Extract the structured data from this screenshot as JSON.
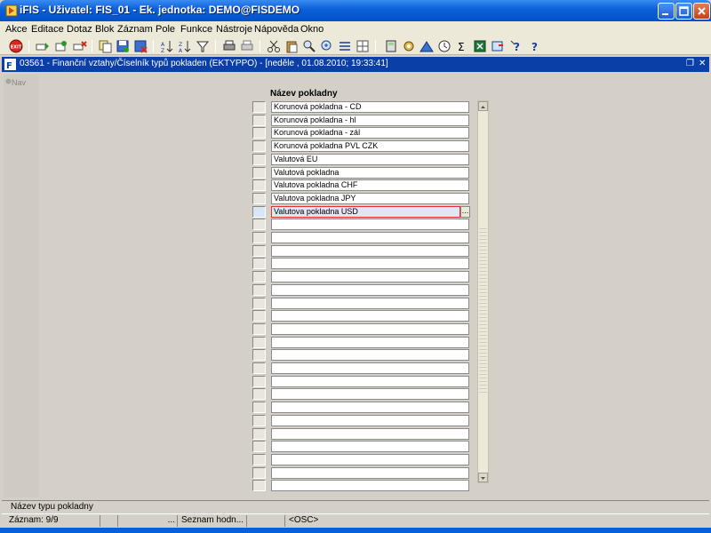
{
  "window": {
    "title": "iFIS - Uživatel: FIS_01 - Ek. jednotka: DEMO@FISDEMO"
  },
  "menu": [
    "Akce",
    "Editace",
    "Dotaz",
    "Blok",
    "Záznam",
    "Pole",
    "Funkce",
    "Nástroje",
    "Nápověda",
    "Okno"
  ],
  "toolbar": {
    "icons": [
      "exit-icon",
      "insert-record-icon",
      "duplicate-record-icon",
      "delete-record-icon",
      "copy-icon",
      "save-icon",
      "cancel-icon",
      "sort-asc-icon",
      "sort-desc-icon",
      "filter-icon",
      "print-icon",
      "print-preview-icon",
      "cut-icon",
      "paste-icon",
      "find-icon",
      "zoom-icon",
      "list-icon",
      "columns-icon",
      "calc-icon",
      "gear-icon",
      "chart-icon",
      "clock-icon",
      "sum-icon",
      "excel-icon",
      "export-icon",
      "help-icon",
      "context-help-icon"
    ],
    "exit_label": "EXIT"
  },
  "form": {
    "title": "03561 - Finanční vztahy/Číselník typů pokladen (EKTYPPO) - [neděle , 01.08.2010; 19:33:41]",
    "nav_label": "Nav",
    "column_header": "Název pokladny",
    "rows": [
      "Korunová pokladna - CD",
      "Korunová pokladna - hl",
      "Korunová pokladna - zál",
      "Korunová pokladna PVL CZK",
      "Valutová EU",
      "Valutová pokladna",
      "Valutova pokladna CHF",
      "Valutova pokladna JPY",
      "Valutova pokladna USD",
      "",
      "",
      "",
      "",
      "",
      "",
      "",
      "",
      "",
      "",
      "",
      "",
      "",
      "",
      "",
      "",
      "",
      "",
      "",
      "",
      ""
    ],
    "active_row_index": 8,
    "lov_button_label": "..."
  },
  "hint": "Název typu pokladny",
  "status": {
    "record": "Záznam: 9/9",
    "ellipsis": "...",
    "list_of_values": "Seznam hodn...",
    "osc": "<OSC>"
  }
}
